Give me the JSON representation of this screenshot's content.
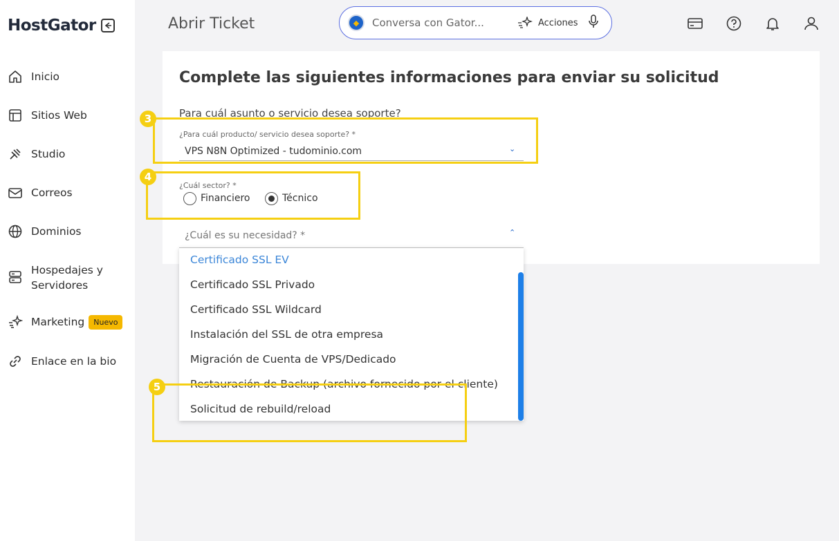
{
  "brand": {
    "logo_text": "HostGator"
  },
  "sidebar": {
    "items": [
      {
        "label": "Inicio",
        "icon": "home-icon"
      },
      {
        "label": "Sitios Web",
        "icon": "layout-icon"
      },
      {
        "label": "Studio",
        "icon": "studio-icon"
      },
      {
        "label": "Correos",
        "icon": "mail-icon"
      },
      {
        "label": "Dominios",
        "icon": "globe-icon"
      },
      {
        "label": "Hospedajes y",
        "label2": "Servidores",
        "icon": "server-icon"
      },
      {
        "label": "Marketing",
        "icon": "sparkle-icon",
        "badge": "Nuevo"
      },
      {
        "label": "Enlace en la bio",
        "icon": "link-icon"
      }
    ]
  },
  "header": {
    "title": "Abrir Ticket",
    "chat_placeholder": "Conversa con Gator...",
    "actions_label": "Acciones"
  },
  "form": {
    "heading": "Complete las siguientes informaciones para enviar su solicitud",
    "question": "Para cuál asunto o servicio desea soporte?",
    "product_label": "¿Para cuál producto/ servicio desea soporte? *",
    "product_value": "VPS N8N Optimized - tudominio.com",
    "sector_label": "¿Cuál sector? *",
    "sector_options": [
      "Financiero",
      "Técnico"
    ],
    "sector_selected": "Técnico",
    "need_label": "¿Cuál es su necesidad? *"
  },
  "dropdown": {
    "items": [
      "Certificado SSL EV",
      "Certificado SSL Privado",
      "Certificado SSL Wildcard",
      "Instalación del SSL de otra empresa",
      "Migración de Cuenta de VPS/Dedicado",
      "Restauración de Backup (archivo fornecido por el cliente)",
      "Solicitud de rebuild/reload"
    ],
    "highlighted": "Certificado SSL EV"
  },
  "annotations": {
    "step3": "3",
    "step4": "4",
    "step5": "5"
  },
  "colors": {
    "accent": "#1d63c8",
    "annotation": "#f5cf12",
    "badge": "#f5b800"
  }
}
